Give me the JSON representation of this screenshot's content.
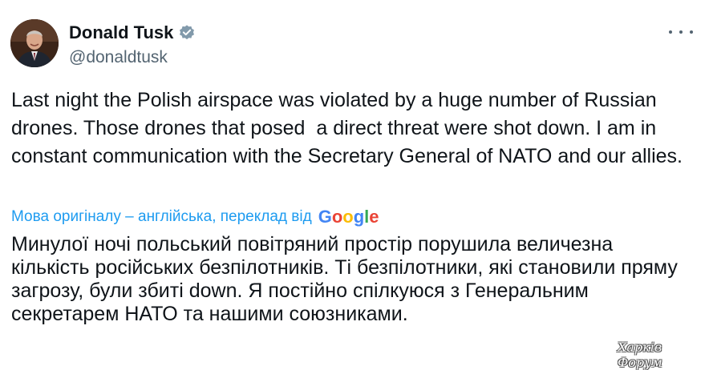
{
  "author": {
    "display_name": "Donald Tusk",
    "handle": "@donaldtusk",
    "verified_badge_icon": "verified-badge-icon",
    "verified_color": "#829aab"
  },
  "menu": {
    "icon": "more-horizontal-icon"
  },
  "tweet": {
    "text": "Last night the Polish airspace was violated by a huge number of Russian drones. Those drones that posed  a direct threat were shot down. I am in constant communication with the Secretary General of NATO and our allies."
  },
  "translation": {
    "note": "Мова оригіналу – англійська, переклад від",
    "provider_letters": [
      "G",
      "o",
      "o",
      "g",
      "l",
      "e"
    ],
    "provider_colors": [
      "#4285f4",
      "#ea4335",
      "#fbbc05",
      "#4285f4",
      "#34a853",
      "#ea4335"
    ],
    "text": "Минулої ночі польський повітряний простір порушила величезна кількість російських безпілотників. Ті безпілотники, які становили пряму загрозу, були збиті down. Я постійно спілкуюся з Генеральним секретарем НАТО та нашими союзниками."
  },
  "watermark": {
    "text": "Харків Форум"
  },
  "colors": {
    "text_primary": "#0f1419",
    "text_secondary": "#536471",
    "link_blue": "#1d9bf0"
  }
}
